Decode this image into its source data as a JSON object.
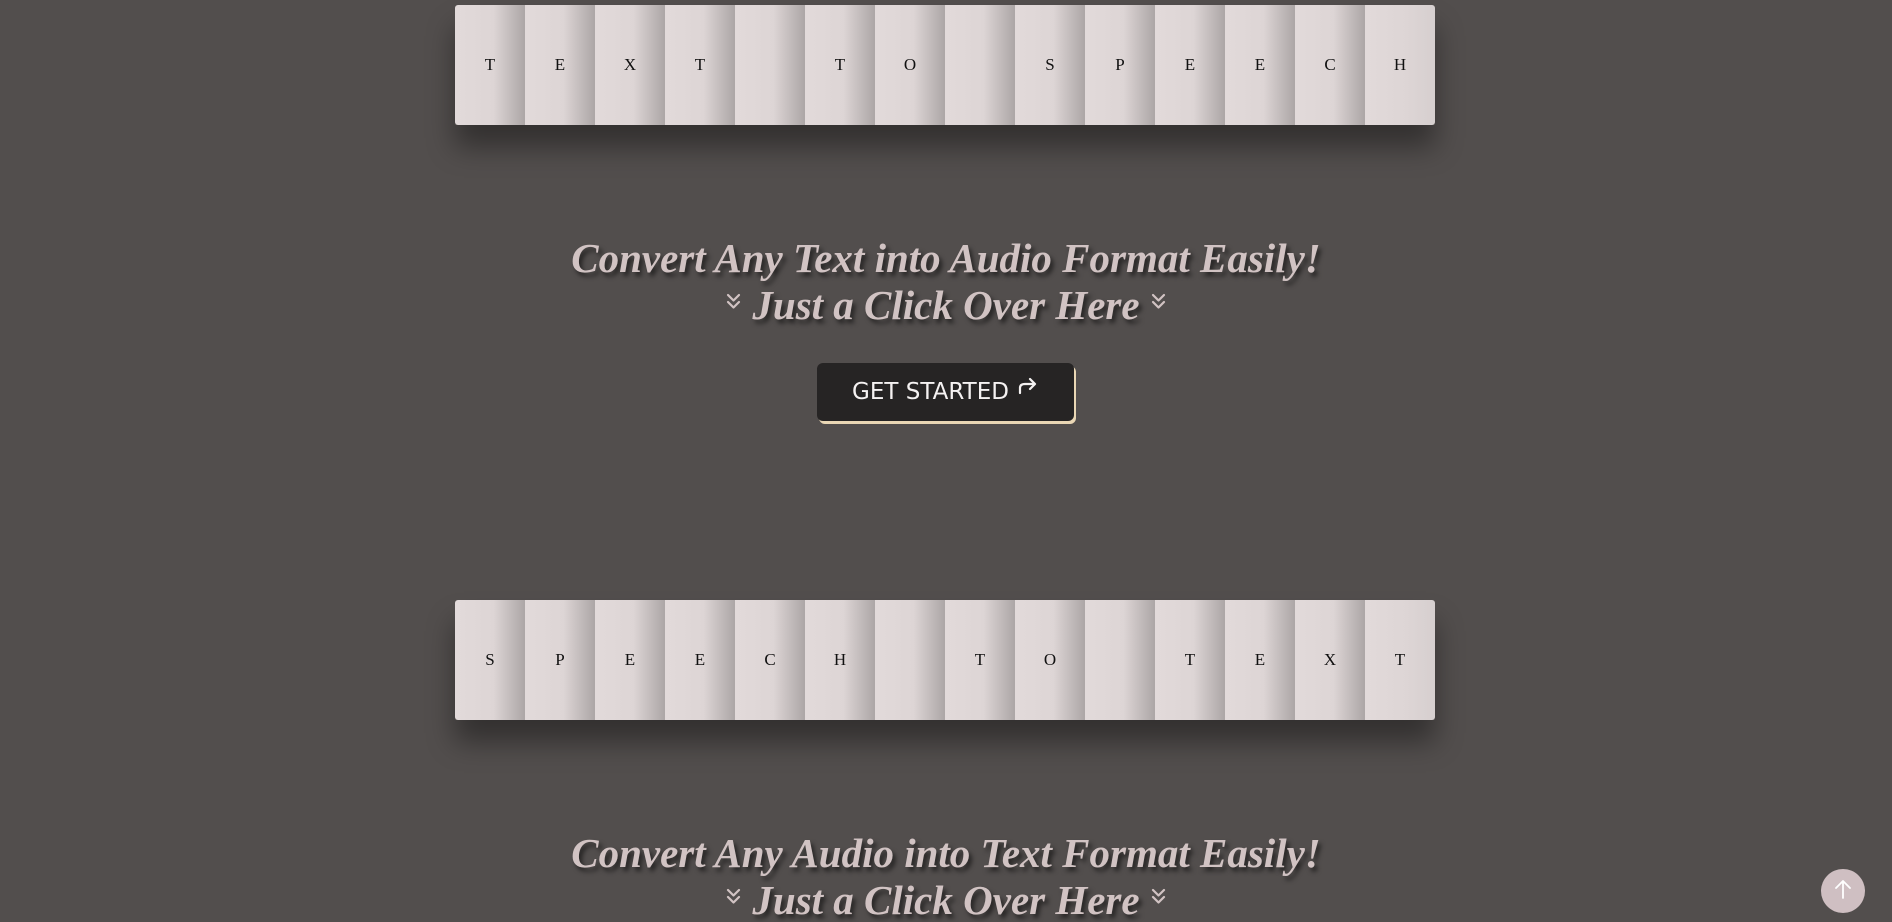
{
  "banner_top": {
    "letters": [
      "T",
      "E",
      "X",
      "T",
      "",
      "T",
      "O",
      "",
      "S",
      "P",
      "E",
      "E",
      "C",
      "H"
    ]
  },
  "section_one": {
    "headline": "Convert Any Text into Audio Format Easily!",
    "subline": "Just a Click Over Here",
    "cta_label": "GET STARTED",
    "cta_icon": "share-arrow-icon"
  },
  "banner_bottom": {
    "letters": [
      "S",
      "P",
      "E",
      "E",
      "C",
      "H",
      "",
      "T",
      "O",
      "",
      "T",
      "E",
      "X",
      "T"
    ]
  },
  "section_two": {
    "headline": "Convert Any Audio into Text Format Easily!",
    "subline": "Just a Click Over Here"
  },
  "scroll_top": {
    "icon": "arrow-up-icon"
  },
  "colors": {
    "background": "#524e4d",
    "tile": "#e2dada",
    "headline": "#d1c3c3",
    "button": "#262424",
    "button_shadow": "#ead7b5",
    "scroll_button": "#cfbfc2"
  }
}
